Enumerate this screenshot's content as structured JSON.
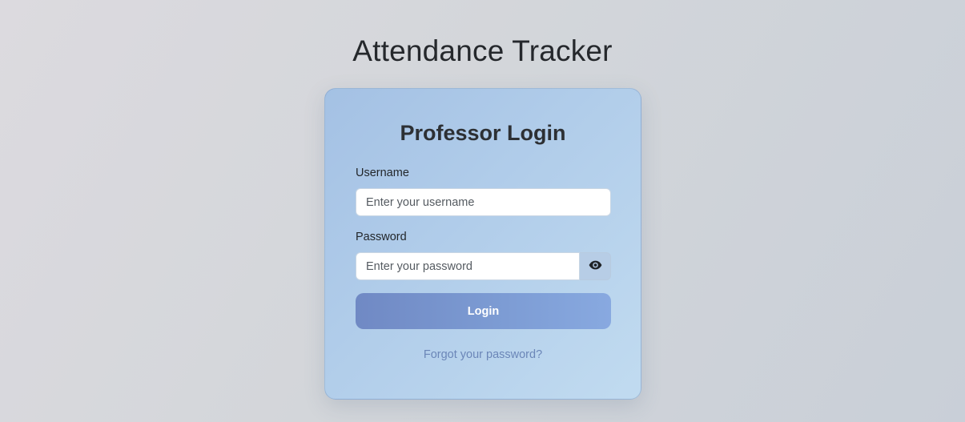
{
  "header": {
    "title": "Attendance Tracker"
  },
  "login_card": {
    "title": "Professor Login",
    "username": {
      "label": "Username",
      "placeholder": "Enter your username",
      "value": ""
    },
    "password": {
      "label": "Password",
      "placeholder": "Enter your password",
      "value": "",
      "toggle_icon": "eye-icon"
    },
    "login_button_label": "Login",
    "forgot_link_label": "Forgot your password?"
  },
  "colors": {
    "login_button": "#7c9bd3",
    "link": "#6b86b8",
    "card": "#b1cdea"
  }
}
